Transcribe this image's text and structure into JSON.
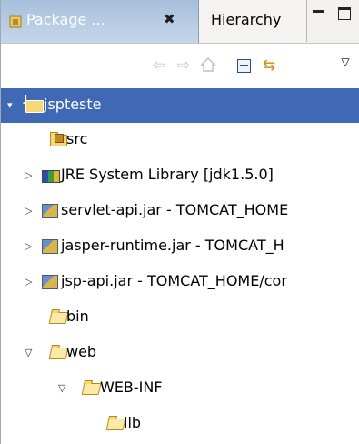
{
  "tabs": {
    "active_label": "Package ...",
    "close_glyph": "✖",
    "inactive_label": "Hierarchy"
  },
  "toolbar": {
    "back_glyph": "⇦",
    "forward_glyph": "⇨",
    "link_glyph": "⇆",
    "menu_glyph": "▽"
  },
  "tree": {
    "project": {
      "label": "jspteste",
      "expanded": true,
      "selected": true
    },
    "items": [
      {
        "label": "src",
        "icon": "package-folder-icon"
      },
      {
        "label": "JRE System Library [jdk1.5.0]",
        "icon": "library-icon",
        "expanded": false
      },
      {
        "label": "servlet-api.jar - TOMCAT_HOME",
        "icon": "jar-icon",
        "expanded": false
      },
      {
        "label": "jasper-runtime.jar - TOMCAT_H",
        "icon": "jar-icon",
        "expanded": false
      },
      {
        "label": "jsp-api.jar - TOMCAT_HOME/cor",
        "icon": "jar-icon",
        "expanded": false
      },
      {
        "label": "bin",
        "icon": "folder-icon"
      },
      {
        "label": "web",
        "icon": "open-folder-icon",
        "expanded": true
      },
      {
        "label": "WEB-INF",
        "icon": "open-folder-icon",
        "expanded": true
      },
      {
        "label": "lib",
        "icon": "folder-icon"
      }
    ],
    "twisty_collapsed": "▷",
    "twisty_expanded": "▽",
    "twisty_selected_expanded": "▾"
  }
}
